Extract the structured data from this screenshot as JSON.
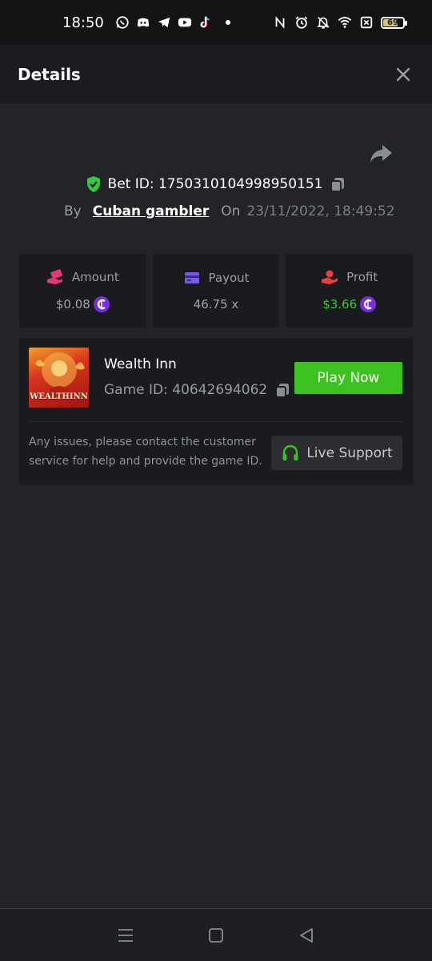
{
  "status_bar": {
    "time": "18:50",
    "notification_icons": [
      "whatsapp-icon",
      "discord-icon",
      "telegram-icon",
      "youtube-icon",
      "tiktok-icon"
    ],
    "system_icons": [
      "nfc-icon",
      "alarm-icon",
      "mute-icon",
      "wifi-icon",
      "sim-off-icon"
    ],
    "battery_level": "69"
  },
  "header": {
    "title": "Details",
    "close_icon": "close-icon"
  },
  "bet": {
    "id_label": "Bet ID: 1750310104998950151",
    "by_label": "By",
    "user": "Cuban gambler",
    "on_label": "On",
    "datetime": "23/11/2022, 18:49:52"
  },
  "stats": {
    "amount": {
      "label": "Amount",
      "value": "$0.08"
    },
    "payout": {
      "label": "Payout",
      "value": "46.75 x"
    },
    "profit": {
      "label": "Profit",
      "value": "$3.66"
    }
  },
  "game": {
    "name": "Wealth Inn",
    "id_label": "Game ID: 40642694062",
    "thumb_text": "WEALTHINN",
    "play_label": "Play Now",
    "support_text": "Any issues, please contact the customer service for help and provide the game ID.",
    "support_label": "Live Support"
  },
  "colors": {
    "background": "#232427",
    "card": "#1a1b1e",
    "accent_green": "#3dc21f",
    "coin_purple": "#7a2be2",
    "shield_green": "#2ecc40"
  }
}
